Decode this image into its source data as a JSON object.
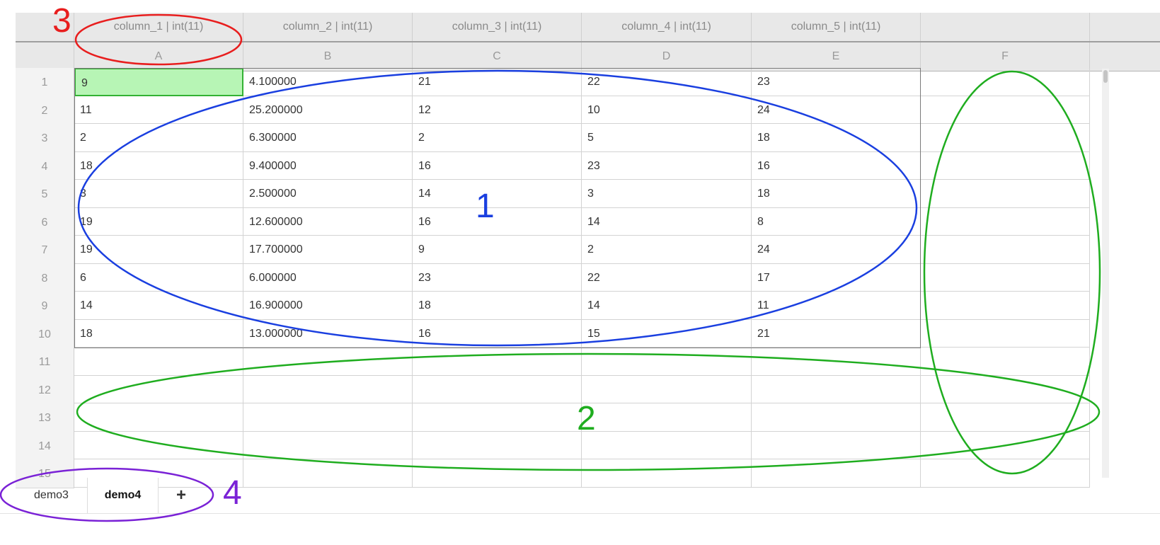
{
  "column_meta": [
    "column_1 | int(11)",
    "column_2 | int(11)",
    "column_3 | int(11)",
    "column_4 | int(11)",
    "column_5 | int(11)",
    ""
  ],
  "column_letters": [
    "A",
    "B",
    "C",
    "D",
    "E",
    "F"
  ],
  "row_numbers": [
    "1",
    "2",
    "3",
    "4",
    "5",
    "6",
    "7",
    "8",
    "9",
    "10",
    "11",
    "12",
    "13",
    "14",
    "15"
  ],
  "rows": [
    [
      "9",
      "4.100000",
      "21",
      "22",
      "23"
    ],
    [
      "11",
      "25.200000",
      "12",
      "10",
      "24"
    ],
    [
      "2",
      "6.300000",
      "2",
      "5",
      "18"
    ],
    [
      "18",
      "9.400000",
      "16",
      "23",
      "16"
    ],
    [
      "3",
      "2.500000",
      "14",
      "3",
      "18"
    ],
    [
      "19",
      "12.600000",
      "16",
      "14",
      "8"
    ],
    [
      "19",
      "17.700000",
      "9",
      "2",
      "24"
    ],
    [
      "6",
      "6.000000",
      "23",
      "22",
      "17"
    ],
    [
      "14",
      "16.900000",
      "18",
      "14",
      "11"
    ],
    [
      "18",
      "13.000000",
      "16",
      "15",
      "21"
    ]
  ],
  "selected_cell": "A1",
  "tabs": [
    {
      "label": "demo3",
      "active": false
    },
    {
      "label": "demo4",
      "active": true
    }
  ],
  "add_tab_label": "+",
  "annotations": [
    {
      "label": "3",
      "color": "#e81e1e"
    },
    {
      "label": "1",
      "color": "#1a3fe0"
    },
    {
      "label": "2",
      "color": "#1fad1f"
    },
    {
      "label": "4",
      "color": "#7a22d6"
    }
  ],
  "colors": {
    "selected_fill": "#b7f5b5",
    "selected_border": "#33b233",
    "header_bg": "#e8e8e8"
  }
}
